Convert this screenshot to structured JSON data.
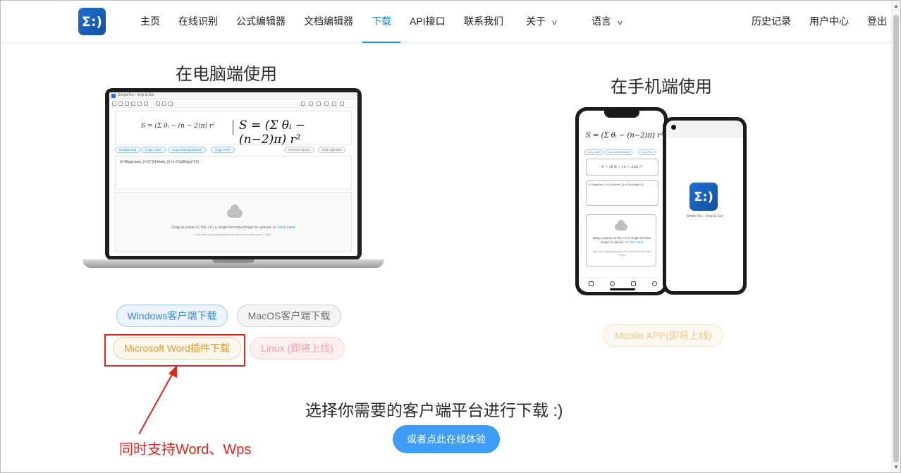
{
  "header": {
    "logo_text": "Σ:)",
    "nav": [
      "主页",
      "在线识别",
      "公式编辑器",
      "文档编辑器",
      "下载",
      "API接口",
      "联系我们",
      "关于",
      "语言"
    ],
    "right": [
      "历史记录",
      "用户中心",
      "登出"
    ],
    "active": "下载"
  },
  "main": {
    "desktop_title": "在电脑端使用",
    "mobile_title": "在手机端使用",
    "buttons": {
      "windows": "Windows客户端下载",
      "macos": "MacOS客户端下载",
      "word": "Microsoft Word插件下载",
      "linux": "Linux (即将上线)",
      "mobile": "Mobile APP(即将上线)"
    },
    "choose_text": "选择你需要的客户端平台进行下载 :)",
    "try_online": "或者点此在线体验",
    "annotation": "同时支持Word、Wps"
  },
  "laptop": {
    "window_title": "SimpleTex - Snip & Get",
    "formula_small": "S = (Σ θᵢ − (n − 2)π) r²",
    "formula_big": "S = (Σ θᵢ − (n−2)π) r²",
    "buttons": [
      "Disable Edit",
      "Copy Latex",
      "Copy MathML(Word)",
      "Copy PNG",
      "Remove Space",
      "Hide Uploads"
    ],
    "latex": "S=\\Bigg(\\sum_{i=1}^{n}\\theta_{i}-(n-2)\\pi\\Bigg)r^{2}",
    "upload_line1": "Drag or paste (CTRL+V) a single formula image to upload, or",
    "upload_link": "Click Here",
    "upload_line2": "Only allow jpg/jpeg/png/bmp file which is smaller than 7.5MB !"
  },
  "phone": {
    "formula": "S = (Σ θᵢ − (n−2)π) r²",
    "buttons": [
      "Copy Latex",
      "Copy MathML(Word)",
      "Copy PNG"
    ],
    "box1": "S = (Σ θᵢ − (n − 2)π) r²",
    "latex": "S=\\Bigg(\\sum_{i=1}^{n}\\theta_{i}-(n-2)\\pi\\Bigg)r^{2}",
    "upload_line1": "Drag or paste (CTRL+V) a single formula image to upload, or",
    "upload_link": "Click Here",
    "upload_line2": "Only allow jpg/jpeg/png/bmp file which is smaller than 7.5MB !",
    "app_name": "SimpleTex - Snip & Get"
  }
}
